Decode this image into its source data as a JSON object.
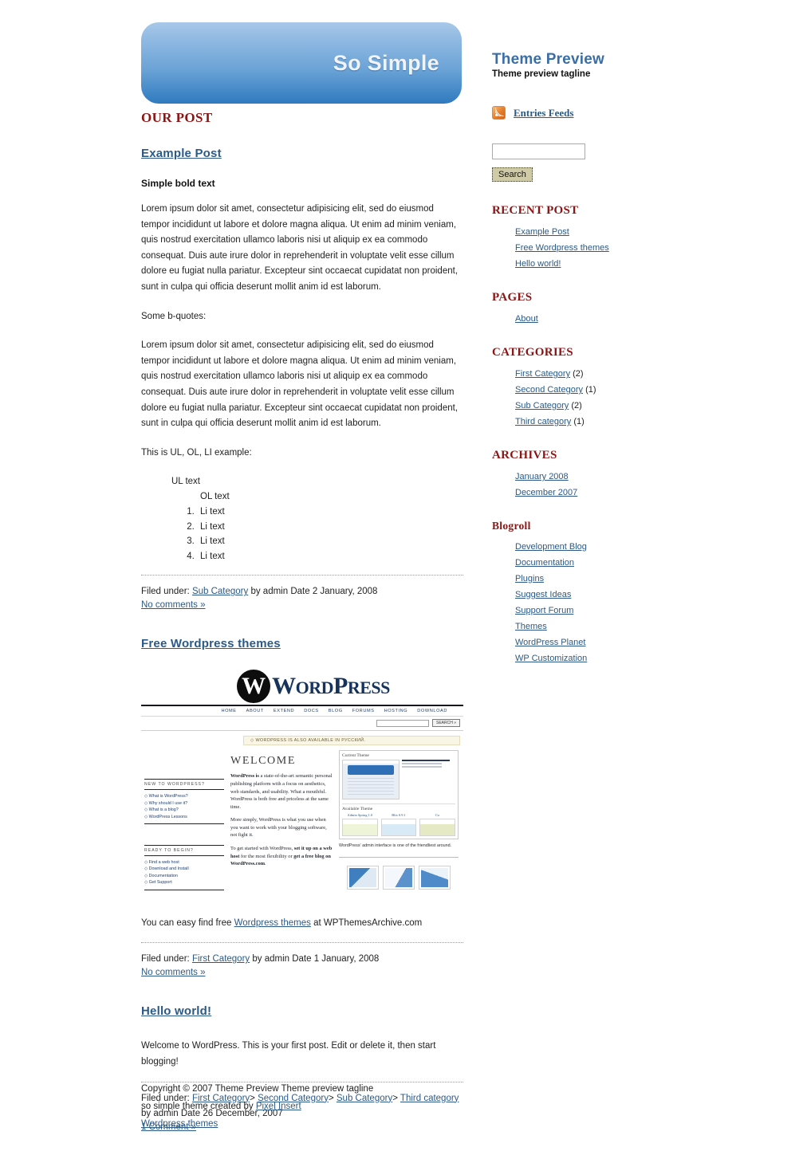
{
  "banner": {
    "title": "So Simple"
  },
  "site": {
    "title": "Theme Preview",
    "tagline": "Theme preview tagline"
  },
  "sidebar": {
    "feed_label": "Entries Feeds",
    "search": {
      "value": "",
      "placeholder": "",
      "button_label": "Search"
    },
    "sections": [
      {
        "heading": "RECENT POST",
        "items": [
          {
            "label": "Example Post"
          },
          {
            "label": "Free Wordpress themes"
          },
          {
            "label": "Hello world!"
          }
        ]
      },
      {
        "heading": "PAGES",
        "items": [
          {
            "label": "About"
          }
        ]
      },
      {
        "heading": "CATEGORIES",
        "items": [
          {
            "label": "First Category",
            "count": "(2)"
          },
          {
            "label": "Second Category",
            "count": "(1)"
          },
          {
            "label": "Sub Category",
            "count": "(2)"
          },
          {
            "label": "Third category",
            "count": "(1)"
          }
        ]
      },
      {
        "heading": "ARCHIVES",
        "items": [
          {
            "label": "January 2008"
          },
          {
            "label": "December 2007"
          }
        ]
      },
      {
        "heading": "Blogroll",
        "items": [
          {
            "label": "Development Blog"
          },
          {
            "label": "Documentation"
          },
          {
            "label": "Plugins"
          },
          {
            "label": "Suggest Ideas"
          },
          {
            "label": "Support Forum"
          },
          {
            "label": "Themes"
          },
          {
            "label": "WordPress Planet"
          },
          {
            "label": "WP Customization"
          }
        ]
      }
    ]
  },
  "main": {
    "section_heading": "OUR POST",
    "post1": {
      "title": "Example Post",
      "bold_lead": "Simple bold text",
      "para1": "Lorem ipsum dolor sit amet, consectetur adipisicing elit, sed do eiusmod tempor incididunt ut labore et dolore magna aliqua. Ut enim ad minim veniam, quis nostrud exercitation ullamco laboris nisi ut aliquip ex ea commodo consequat. Duis aute irure dolor in reprehenderit in voluptate velit esse cillum dolore eu fugiat nulla pariatur. Excepteur sint occaecat cupidatat non proident, sunt in culpa qui officia deserunt mollit anim id est laborum.",
      "quote_intro": "Some b-quotes:",
      "para2": "Lorem ipsum dolor sit amet, consectetur adipisicing elit, sed do eiusmod tempor incididunt ut labore et dolore magna aliqua. Ut enim ad minim veniam, quis nostrud exercitation ullamco laboris nisi ut aliquip ex ea commodo consequat. Duis aute irure dolor in reprehenderit in voluptate velit esse cillum dolore eu fugiat nulla pariatur. Excepteur sint occaecat cupidatat non proident, sunt in culpa qui officia deserunt mollit anim id est laborum.",
      "list_intro": "This is UL, OL, LI example:",
      "ul_text": "UL text",
      "ol_text": "OL text",
      "li_items": [
        "Li text",
        "Li text",
        "Li text",
        "Li text"
      ],
      "meta_prefix": "Filed under:",
      "meta_category": "Sub Category",
      "meta_suffix": "by admin Date 2 January, 2008",
      "comments": "No comments »"
    },
    "post2": {
      "title": "Free Wordpress themes",
      "caption_prefix": "You can easy find free",
      "caption_link": "Wordpress themes",
      "caption_suffix": "at WPThemesArchive.com",
      "meta_prefix": "Filed under:",
      "meta_category": "First Category",
      "meta_suffix": "by admin Date 1 January, 2008",
      "comments": "No comments »"
    },
    "post3": {
      "title": "Hello world!",
      "para1": "Welcome to WordPress. This is your first post. Edit or delete it, then start blogging!",
      "meta_prefix": "Filed under:",
      "meta_categories": [
        "First Category",
        "Second Category",
        "Sub Category",
        "Third category"
      ],
      "meta_separator": ">",
      "meta_suffix": "by admin Date 26 December, 2007",
      "comments": "1 Comment »"
    }
  },
  "wp_screenshot": {
    "logo_word_a": "W",
    "logo_word_b": "ORD",
    "logo_word_c": "P",
    "logo_word_d": "RESS",
    "logo_mark": "W",
    "nav": [
      "HOME",
      "ABOUT",
      "EXTEND",
      "DOCS",
      "BLOG",
      "FORUMS",
      "HOSTING",
      "DOWNLOAD"
    ],
    "search_button": "SEARCH »",
    "notice": "◇ WORDPRESS IS ALSO AVAILABLE IN РУССКИЙ.",
    "col1_head1": "NEW TO WORDPRESS?",
    "col1_links1": [
      "◇ What is WordPress?",
      "◇ Why should I use it?",
      "◇ What is a blog?",
      "◇ WordPress Lessons"
    ],
    "col1_head2": "READY TO BEGIN?",
    "col1_links2": [
      "◇ Find a web host",
      "◇ Download and Install",
      "◇ Documentation",
      "◇ Get Support"
    ],
    "welcome": "WELCOME",
    "para1_bold": "WordPress is",
    "para1": " a state-of-the-art semantic personal publishing platform with a focus on aesthetics, web standards, and usability. What a mouthful. WordPress is both free and priceless at the same time.",
    "para2": "More simply, WordPress is what you use when you want to work with your blogging software, not fight it.",
    "para3_a": "To get started with WordPress, ",
    "para3_b": "set it up on a web host",
    "para3_c": " for the most flexibility or ",
    "para3_d": "get a free blog on WordPress.com",
    "para3_e": ".",
    "panel_current": "Current Theme",
    "panel_avail": "Available Theme",
    "avail_items": [
      "Admin Spring 1.0",
      "Blix 0.9.1",
      "Co"
    ],
    "panel_caption": "WordPress' admin interface is one of the friendliest around."
  },
  "footer": {
    "line1": "Copyright © 2007 Theme Preview Theme preview tagline",
    "line2_prefix": "so simple theme created by",
    "line2_link": "Pixel Insert",
    "line3_link": "Wordpress themes"
  }
}
